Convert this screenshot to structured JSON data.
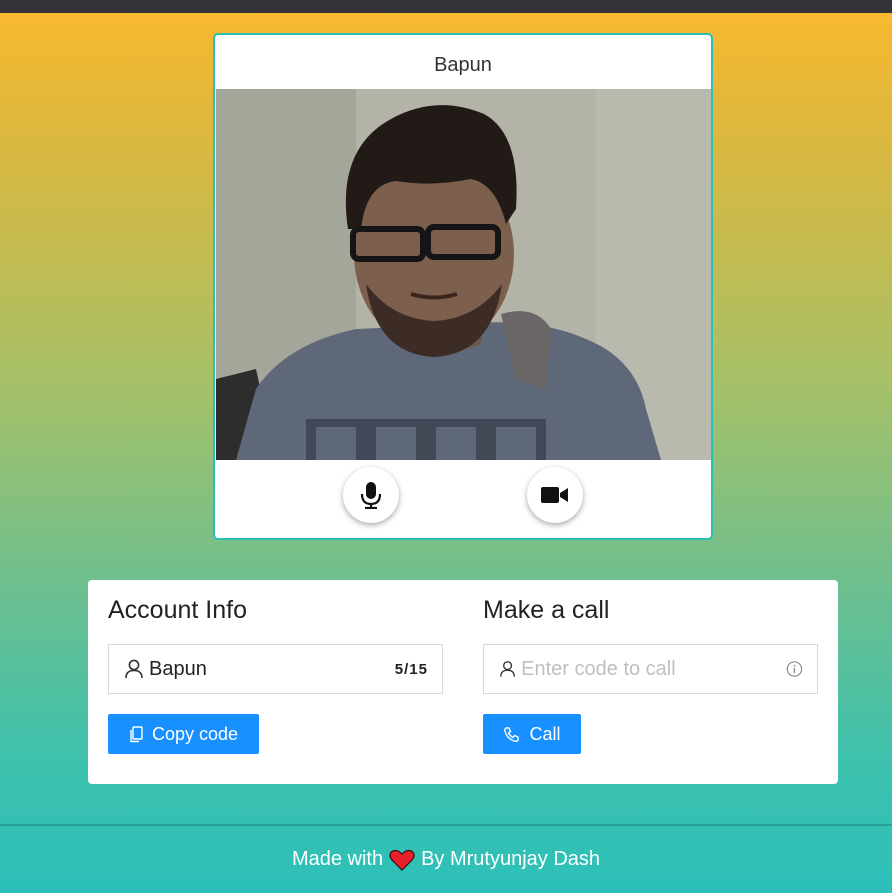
{
  "video": {
    "caller_name": "Bapun",
    "mic_icon": "microphone-icon",
    "camera_icon": "video-camera-icon"
  },
  "account": {
    "title": "Account Info",
    "name_value": "Bapun",
    "name_counter": "5/15",
    "copy_label": "Copy code",
    "user_icon": "user-icon",
    "copy_icon": "copy-icon"
  },
  "call": {
    "title": "Make a call",
    "code_placeholder": "Enter code to call",
    "code_value": "",
    "call_label": "Call",
    "info_icon": "info-icon",
    "phone_icon": "phone-icon"
  },
  "footer": {
    "made_with": "Made with",
    "by_text": "By Mrutyunjay Dash",
    "heart_icon": "heart-icon"
  },
  "colors": {
    "primary_button": "#1890ff",
    "card_border": "#2bbfb7",
    "topbar": "#333437"
  }
}
